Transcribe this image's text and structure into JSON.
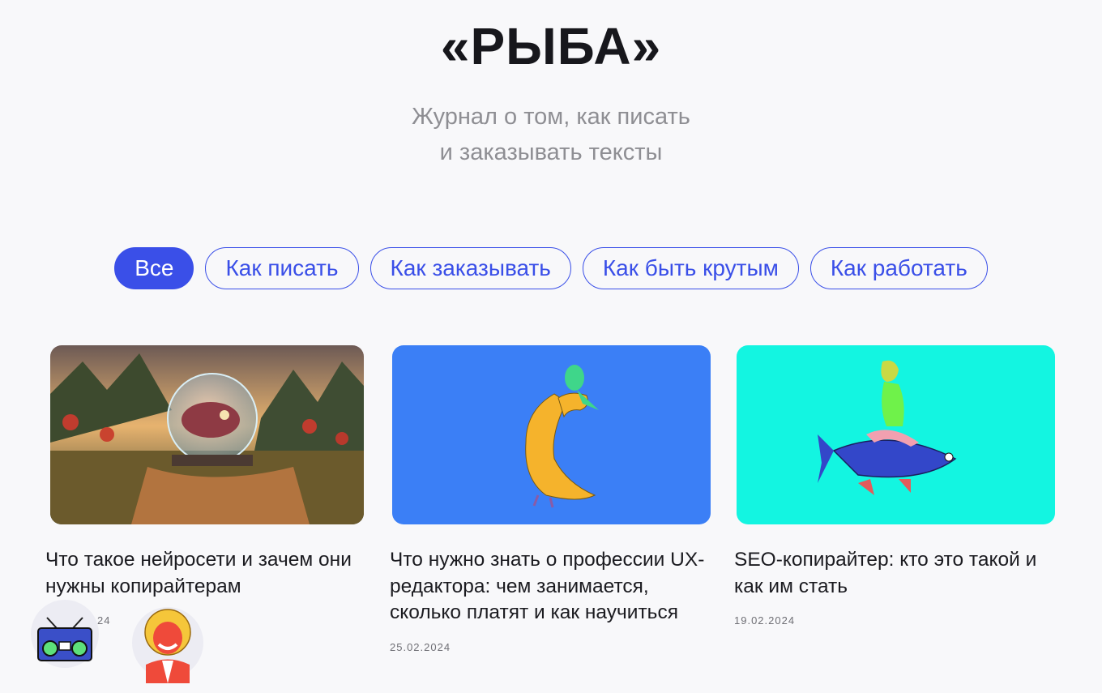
{
  "header": {
    "title": "«РЫБА»",
    "subtitle_line1": "Журнал о том, как писать",
    "subtitle_line2": "и заказывать тексты"
  },
  "filters": [
    {
      "label": "Все",
      "active": true
    },
    {
      "label": "Как писать",
      "active": false
    },
    {
      "label": "Как заказывать",
      "active": false
    },
    {
      "label": "Как быть крутым",
      "active": false
    },
    {
      "label": "Как работать",
      "active": false
    }
  ],
  "articles": [
    {
      "title": "Что такое нейросети и зачем они нужны копирайтерам",
      "date": "24",
      "image": "fantasy-fish-bubble-landscape"
    },
    {
      "title": "Что нужно знать о профессии UX-редактора: чем занимается, сколько платят и как научиться",
      "date": "25.02.2024",
      "image": "yellow-bird-hand-on-blue"
    },
    {
      "title": "SEO-копирайтер: кто это такой и как им стать",
      "date": "19.02.2024",
      "image": "diver-riding-fish-on-cyan"
    }
  ],
  "stickers": [
    "boombox-sticker",
    "laughing-woman-sticker"
  ],
  "colors": {
    "accent": "#3a4fe8",
    "card2_bg": "#3b7ff6",
    "card3_bg": "#13f5e1",
    "background": "#f8f8fa"
  }
}
